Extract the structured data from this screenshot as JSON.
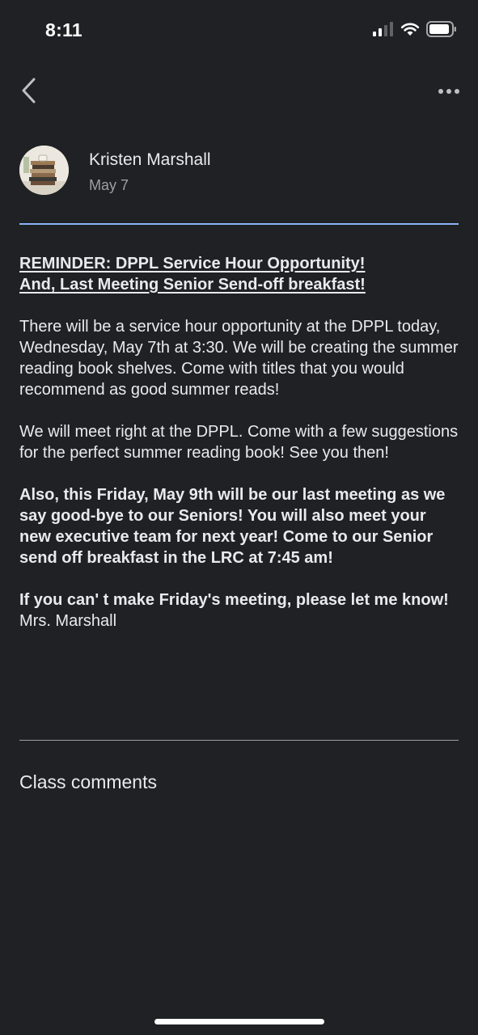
{
  "status_bar": {
    "time": "8:11",
    "icons": [
      "cellular-signal-icon",
      "wifi-icon",
      "battery-icon"
    ]
  },
  "nav": {
    "back_icon": "chevron-left-icon",
    "more_icon": "more-horizontal-icon"
  },
  "post": {
    "author": "Kristen Marshall",
    "date": "May 7",
    "title_line1": "REMINDER: DPPL Service Hour Opportunity!",
    "title_line2": "And, Last Meeting Senior Send-off breakfast!",
    "paragraph1": "There will be a service hour opportunity at the DPPL today, Wednesday, May 7th at 3:30.  We will be creating the summer reading book shelves. Come with titles that you would recommend as good summer reads!",
    "paragraph2": "We will meet right at the DPPL.  Come with a few suggestions for the perfect summer reading book!  See you then!",
    "paragraph3_bold": "Also, this Friday, May 9th will be our last meeting as we say good-bye to our Seniors!  You will also meet your new executive team for next year!  Come to our Senior send off breakfast in the LRC at 7:45 am!",
    "paragraph4_bold": "If you can' t make Friday's meeting, please let me know!",
    "signature": "Mrs. Marshall"
  },
  "comments": {
    "label": "Class comments"
  },
  "colors": {
    "background": "#202124",
    "text": "#e8eaed",
    "secondary_text": "#9aa0a6",
    "accent_divider": "#8ab4f8"
  }
}
